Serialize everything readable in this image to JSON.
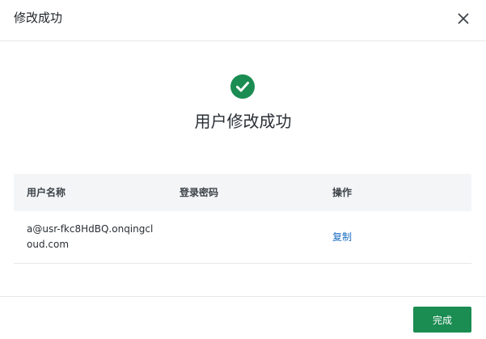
{
  "dialog": {
    "title": "修改成功",
    "close_icon": "close-icon"
  },
  "success": {
    "icon": "check-circle-icon",
    "icon_color": "#1b8c52",
    "message": "用户修改成功"
  },
  "table": {
    "columns": [
      "用户名称",
      "登录密码",
      "操作"
    ],
    "rows": [
      {
        "username": "a@usr-fkc8HdBQ.onqingcloud.com",
        "password": "",
        "action": "复制"
      }
    ]
  },
  "footer": {
    "done_label": "完成",
    "done_color": "#1b8c52"
  }
}
